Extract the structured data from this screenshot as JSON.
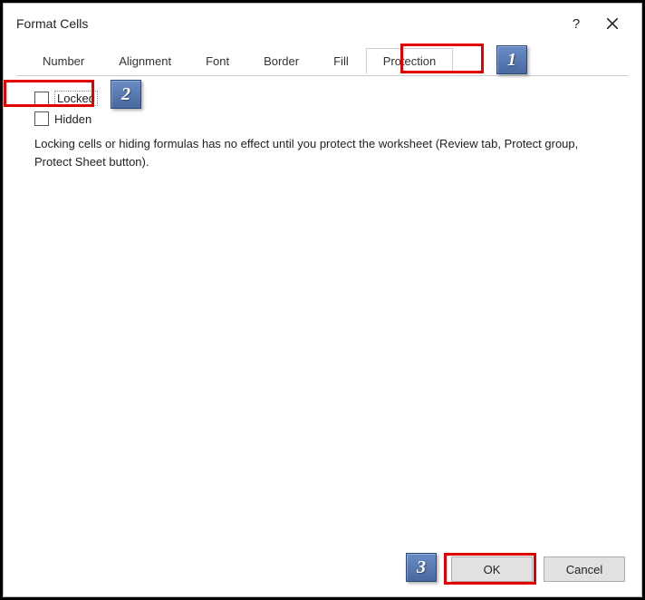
{
  "dialog": {
    "title": "Format Cells",
    "help": "?",
    "tabs": [
      {
        "label": "Number"
      },
      {
        "label": "Alignment"
      },
      {
        "label": "Font"
      },
      {
        "label": "Border"
      },
      {
        "label": "Fill"
      },
      {
        "label": "Protection"
      }
    ],
    "protection": {
      "locked_label": "Locked",
      "hidden_label": "Hidden",
      "info_text": "Locking cells or hiding formulas has no effect until you protect the worksheet (Review tab, Protect group, Protect Sheet button)."
    },
    "buttons": {
      "ok": "OK",
      "cancel": "Cancel"
    }
  },
  "callouts": {
    "c1": "1",
    "c2": "2",
    "c3": "3"
  }
}
